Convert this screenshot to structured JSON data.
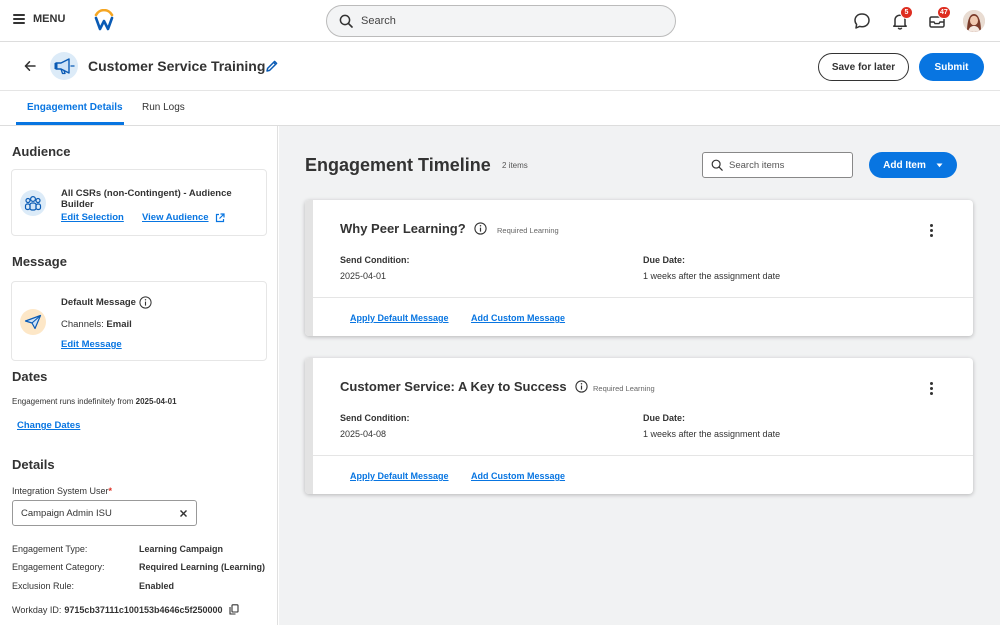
{
  "topbar": {
    "menu_label": "MENU",
    "search_placeholder": "Search",
    "notifications_count": "5",
    "inbox_count": "47"
  },
  "header": {
    "title": "Customer Service Training",
    "save_label": "Save for later",
    "submit_label": "Submit"
  },
  "tabs": [
    {
      "label": "Engagement Details",
      "active": true
    },
    {
      "label": "Run Logs",
      "active": false
    }
  ],
  "left": {
    "audience": {
      "title": "Audience",
      "name": "All CSRs (non-Contingent) - Audience Builder",
      "edit_link": "Edit Selection",
      "view_link": "View Audience"
    },
    "message": {
      "title": "Message",
      "name": "Default Message",
      "channels_label": "Channels:",
      "channels_value": "Email",
      "edit_link": "Edit Message"
    },
    "dates": {
      "title": "Dates",
      "text": "Engagement runs indefinitely from",
      "start_date": "2025-04-01",
      "change_link": "Change Dates"
    },
    "details": {
      "title": "Details",
      "isu_label": "Integration System User",
      "required_mark": "*",
      "isu_value": "Campaign Admin ISU",
      "fields": [
        {
          "label": "Engagement Type:",
          "value": "Learning Campaign"
        },
        {
          "label": "Engagement Category:",
          "value": "Required Learning (Learning)"
        },
        {
          "label": "Exclusion Rule:",
          "value": "Enabled"
        }
      ],
      "workday_id_label": "Workday ID:",
      "workday_id_value": "9715cb37111c100153b4646c5f250000"
    }
  },
  "main": {
    "title": "Engagement Timeline",
    "item_count": "2 items",
    "search_placeholder": "Search items",
    "add_item_label": "Add Item",
    "cards": [
      {
        "title": "Why Peer Learning?",
        "tag": "Required Learning",
        "send_label": "Send Condition:",
        "send_value": "2025-04-01",
        "due_label": "Due Date:",
        "due_value": "1 weeks after the assignment date",
        "apply_link": "Apply Default Message",
        "custom_link": "Add Custom Message"
      },
      {
        "title": "Customer Service: A Key to Success",
        "tag": "Required Learning",
        "send_label": "Send Condition:",
        "send_value": "2025-04-08",
        "due_label": "Due Date:",
        "due_value": "1 weeks after the assignment date",
        "apply_link": "Apply Default Message",
        "custom_link": "Add Custom Message"
      }
    ]
  },
  "colors": {
    "accent": "#0875e1",
    "badge": "#de2e21",
    "background_main": "#f1f2f3"
  }
}
